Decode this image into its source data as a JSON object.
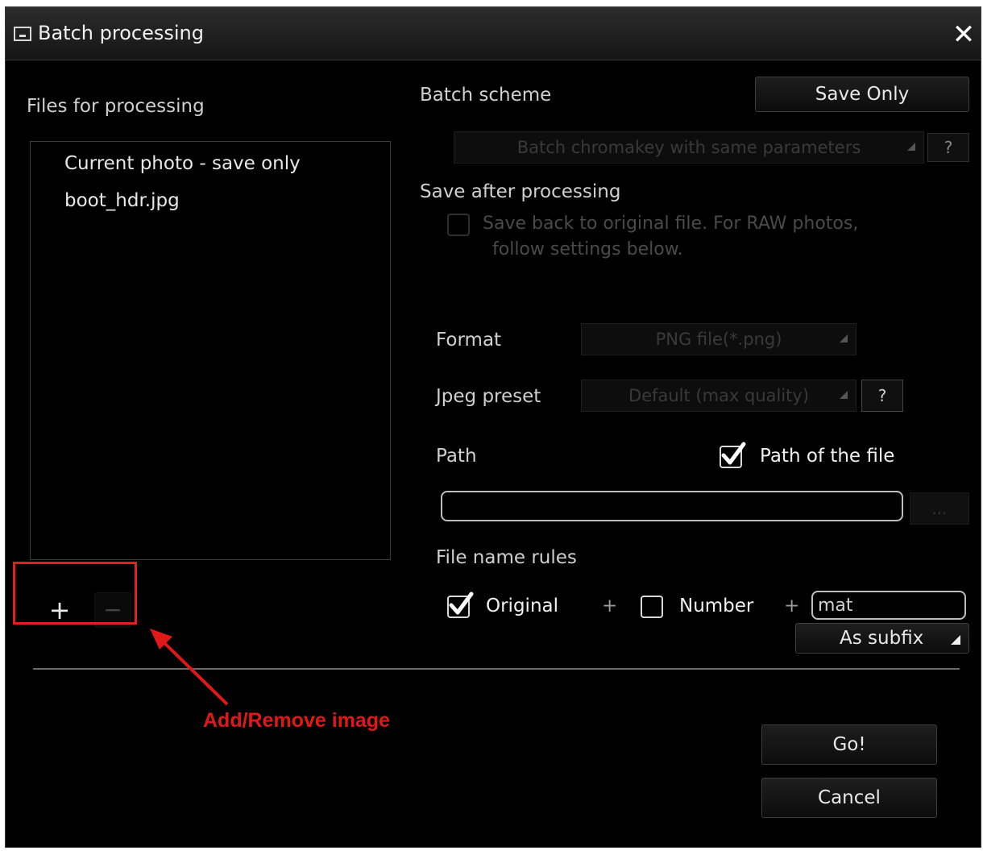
{
  "window": {
    "title": "Batch processing",
    "title_icon": "window-icon",
    "close_icon": "close-icon",
    "close_glyph": "✕"
  },
  "files": {
    "label": "Files for processing",
    "items": [
      "Current photo - save only",
      "boot_hdr.jpg"
    ],
    "add_glyph": "+",
    "remove_glyph": "−"
  },
  "scheme": {
    "label": "Batch scheme",
    "save_only_button": "Save Only",
    "dropdown_value": "Batch chromakey with same parameters",
    "help": "?"
  },
  "save_after": {
    "label": "Save after processing",
    "checkbox_line1": "Save back to original file. For RAW photos,",
    "checkbox_line2": "follow settings below.",
    "checked": false
  },
  "format": {
    "label": "Format",
    "value": "PNG file(*.png)"
  },
  "jpeg": {
    "label": "Jpeg preset",
    "value": "Default (max quality)",
    "help": "?"
  },
  "path": {
    "label": "Path",
    "checkbox_label": "Path of the file",
    "checked": true,
    "value": "",
    "browse": "..."
  },
  "filename": {
    "label": "File name rules",
    "original_label": "Original",
    "original_checked": true,
    "plus": "+",
    "number_label": "Number",
    "number_checked": false,
    "suffix_value": "mat",
    "position_value": "As subfix"
  },
  "actions": {
    "go": "Go!",
    "cancel": "Cancel"
  },
  "annotation": {
    "text": "Add/Remove image",
    "color": "#e01818"
  }
}
